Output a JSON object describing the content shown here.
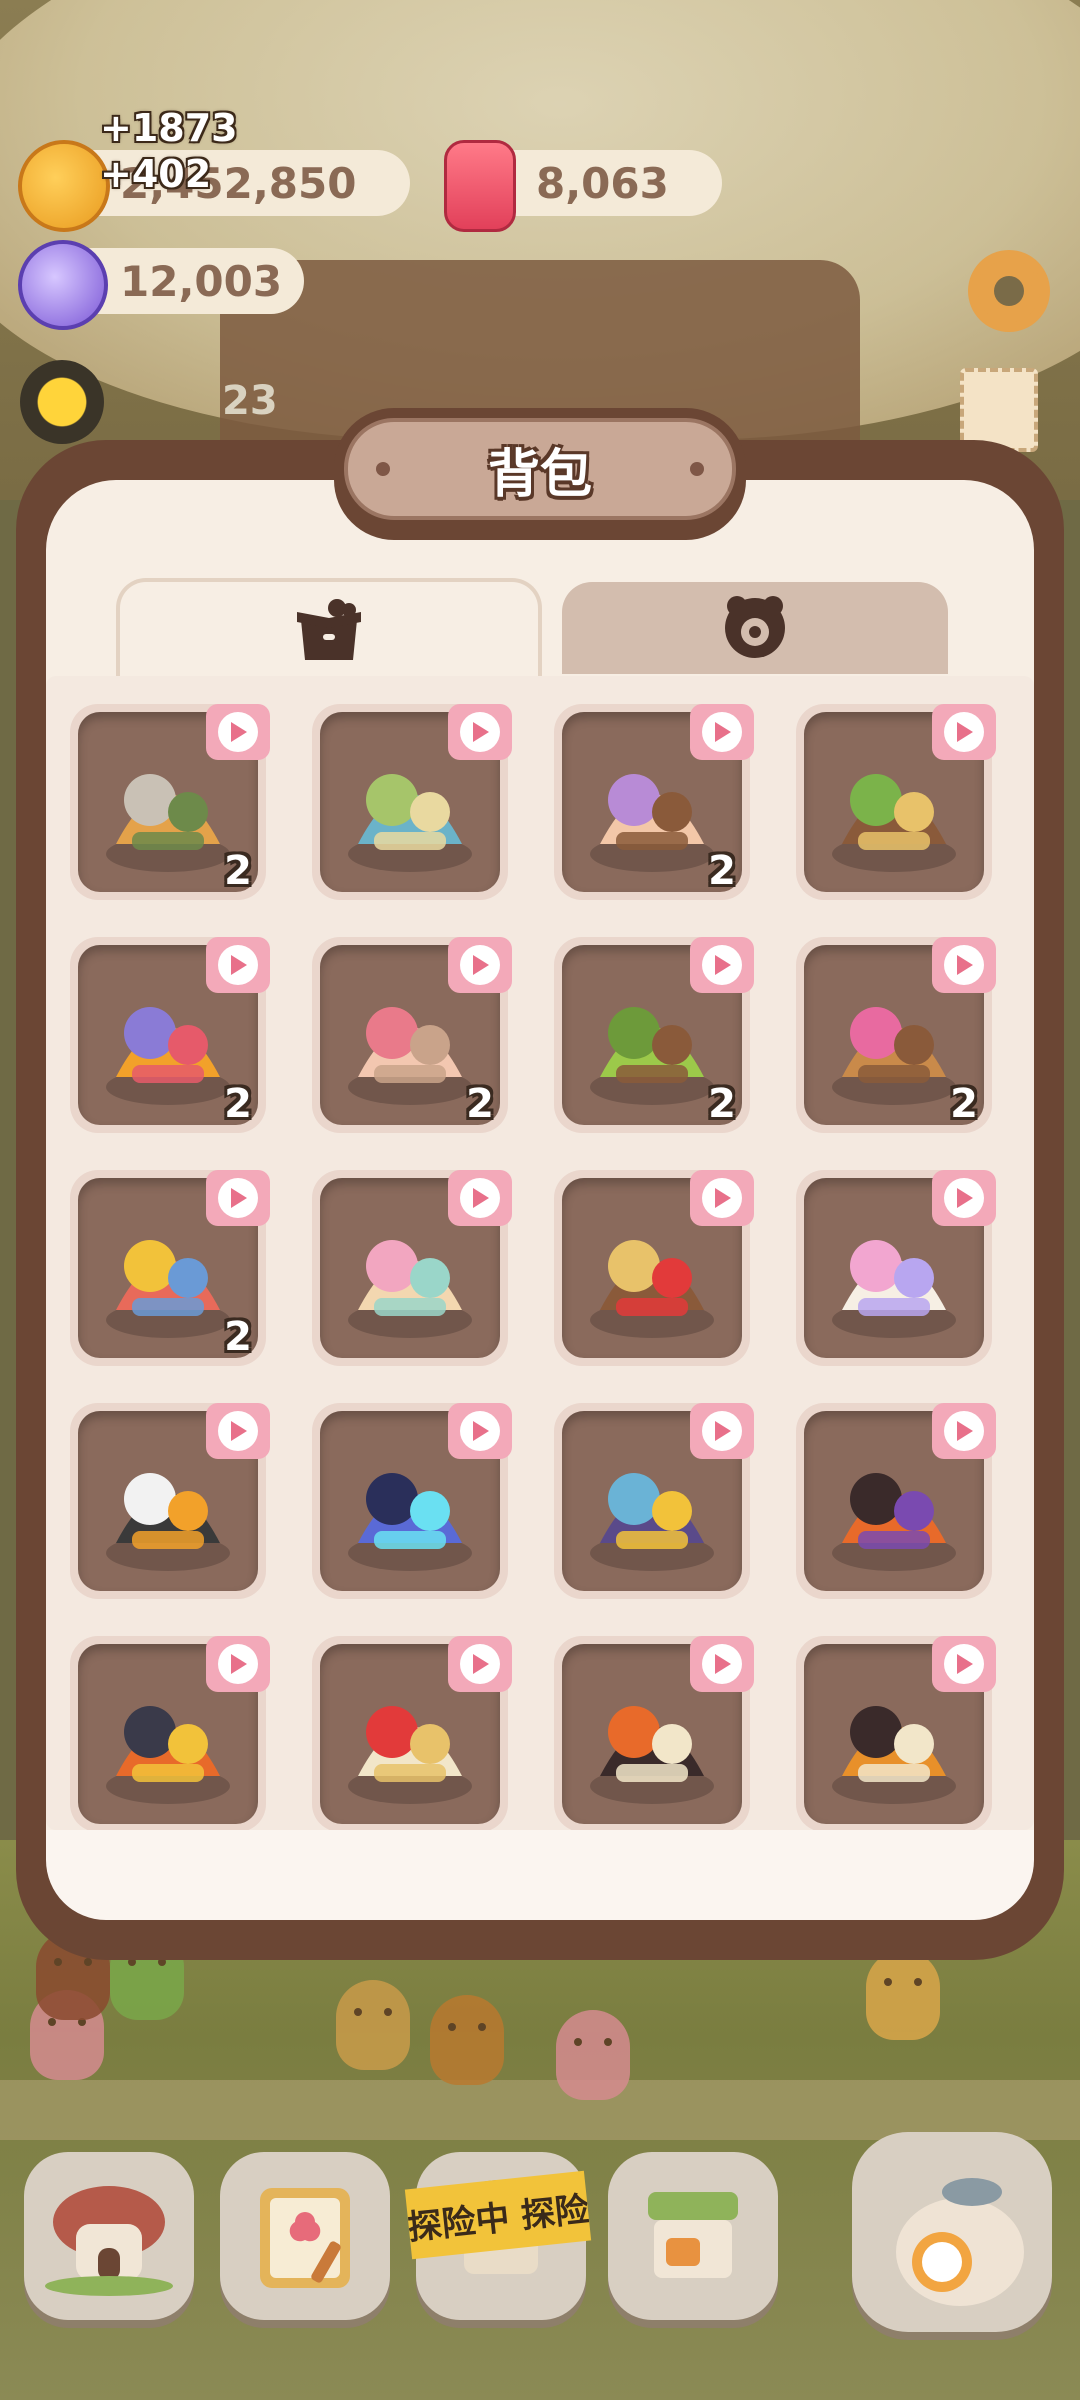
{
  "resources": {
    "cookies": {
      "value": "2,452,850",
      "gain": "+1873",
      "icon": "cookie-coin-icon"
    },
    "cookies_gain2": "+402",
    "crystals": {
      "value": "8,063",
      "icon": "red-crystal-icon"
    },
    "rainbow": {
      "value": "12,003",
      "icon": "rainbow-candy-icon"
    },
    "counter": "23"
  },
  "bag": {
    "title": "背包",
    "tabs": [
      {
        "name": "furniture",
        "icon": "box-icon",
        "active": true
      },
      {
        "name": "decor",
        "icon": "cookie-paw-icon",
        "active": false
      }
    ],
    "items": [
      {
        "name": "bbq-grill-set",
        "count": "2"
      },
      {
        "name": "lily-pond",
        "count": ""
      },
      {
        "name": "cake-bench",
        "count": "2"
      },
      {
        "name": "tree-stump-bird",
        "count": ""
      },
      {
        "name": "balloon-bunch",
        "count": "2"
      },
      {
        "name": "bunny-plush",
        "count": "2"
      },
      {
        "name": "willow-tree",
        "count": "2"
      },
      {
        "name": "teddy-bear",
        "count": "2"
      },
      {
        "name": "hopscotch-mat",
        "count": "2"
      },
      {
        "name": "pastel-slide",
        "count": ""
      },
      {
        "name": "bouncy-castle",
        "count": ""
      },
      {
        "name": "unicorn-plush",
        "count": ""
      },
      {
        "name": "panda-miner",
        "count": ""
      },
      {
        "name": "arcade-cabinet",
        "count": ""
      },
      {
        "name": "magic-cauldron",
        "count": ""
      },
      {
        "name": "halloween-cart",
        "count": ""
      },
      {
        "name": "pumpkin-mirror",
        "count": ""
      },
      {
        "name": "candle-cake-altar",
        "count": ""
      },
      {
        "name": "spooky-display",
        "count": ""
      },
      {
        "name": "tiger-statue",
        "count": ""
      }
    ]
  },
  "nav": {
    "explore_tape": "探险中 探险",
    "buttons": [
      "mushroom-house-icon",
      "quest-book-icon",
      "explore-icon",
      "shop-stall-icon",
      "dragon-alarm-icon"
    ]
  },
  "colors": {
    "panel_frame": "#6b4634",
    "slot_bg": "#8a6a5c",
    "badge_pink": "#f3a9b9"
  }
}
